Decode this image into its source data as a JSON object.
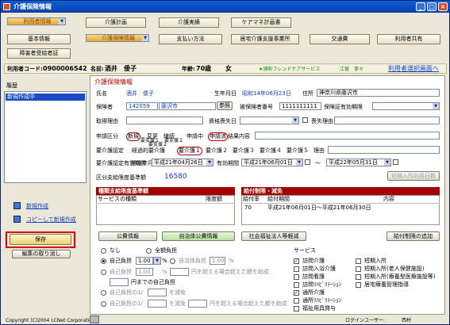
{
  "window": {
    "title": "介護保険情報"
  },
  "tabs_row1": [
    "利用者情報",
    "介護計画",
    "介護実績",
    "ケアマネ計画書"
  ],
  "tabs_row2": [
    "基本情報",
    "介護保険情報",
    "支払い方法",
    "居宅介護支援事業所",
    "交通費",
    "利用者共有"
  ],
  "tabs_row3": [
    "障害者受給者証"
  ],
  "header": {
    "user_code_label": "利用者コード:",
    "user_code": "0900006542",
    "name_label": "名前:",
    "name": "酒井　倭子",
    "age_label": "年齢:",
    "age": "70歳",
    "sex": "女",
    "office": "★浦和フレンドケアサービス",
    "staff": "江留　寧々",
    "select_link": "利用者選択画面へ"
  },
  "left": {
    "history_label": "履歴",
    "history_items": [
      "新規作成中"
    ],
    "new_link": "新規作成",
    "copy_link": "コピーして新規作成",
    "save_button": "保存",
    "cancel_button": "編集の取り消し"
  },
  "form": {
    "section_title": "介護保険情報",
    "name_label": "氏名",
    "name_value": "酒井　倭子",
    "birth_label": "生年月日",
    "birth_value": "昭和14年06月23日",
    "address_label": "住所",
    "address_value": "神奈川県藤沢市",
    "insurer_label": "保険者",
    "insurer_code": "142059",
    "insurer_city": "藤沢市",
    "ref_button": "参照",
    "insured_no_label": "被保険者番号",
    "insured_no": "1111111111",
    "cert_valid_label": "保険証有効期限",
    "acquire_reason_label": "取得理由",
    "loss_date_label": "資格喪失日",
    "loss_reason_label": "喪失理由",
    "apply_label": "申請区分",
    "apply_opts": [
      "新規",
      "変更",
      "継続",
      "申請中",
      "申請済",
      "結果内容"
    ],
    "shien_line1": "要支援１　要支援２",
    "shien_line2": "要支援２",
    "care_level_label": "要介護認定",
    "care_levels": [
      "経過的要介護",
      "要介護１",
      "要介護２",
      "要介護３",
      "要介護４",
      "要介護５",
      "理由"
    ],
    "period_label": "要介護認定有効期間",
    "period_start_label": "開始年月日",
    "period_start": "平成21年04月26日",
    "valid_label": "有効期間",
    "valid_start": "平成21年06月01日",
    "tilde": "～",
    "valid_end": "平成22年05月31日",
    "limit_label": "区分支給限度基準額",
    "limit_value": "16580",
    "short_stay_button": "短期入所利用日数",
    "grid1_title": "種類支給限度基準額",
    "grid1_cols": [
      "サービスの種類",
      "限度額"
    ],
    "grid2_title": "給付制限・減免",
    "grid2_cols": [
      "給付率",
      "給付期間",
      "内容"
    ],
    "grid2_row": [
      "70",
      "平成21年06月01日～平成21年06月30日",
      ""
    ],
    "btn_public": "公費情報",
    "btn_self_public": "自治体公費情報",
    "btn_welfare": "社会福祉法人等軽減",
    "btn_add_limit": "給付制限の追加",
    "burden": {
      "none": "なし",
      "full": "全額負担",
      "self": "自己負担",
      "self_value": "1.00",
      "pct": "%",
      "local": "自治体負担",
      "local_value": "1.00",
      "self2": "自己負担",
      "self2_value": "1.00",
      "over_text": "円を超える場合超えた額を助成",
      "yen_self": "円までの自己負担",
      "self_frac": "自己負担の1/",
      "exempt": "を減免",
      "self_frac2": "自己負担の1/",
      "exempt2": "を減免",
      "over_text2": "円を超える場合超えた額を助成"
    },
    "services_label": "サービス",
    "services_left": [
      {
        "label": "訪問介護",
        "checked": true
      },
      {
        "label": "訪問入浴介護",
        "checked": false
      },
      {
        "label": "訪問看護",
        "checked": false
      },
      {
        "label": "訪問ﾘﾊﾋﾞﾘﾃｰｼｮﾝ",
        "checked": false
      },
      {
        "label": "通所介護",
        "checked": true
      },
      {
        "label": "通所ﾘﾊﾋﾞﾘﾃｰｼｮﾝ",
        "checked": false
      },
      {
        "label": "福祉用具貸与",
        "checked": false
      }
    ],
    "services_right": [
      {
        "label": "短期入所",
        "checked": false
      },
      {
        "label": "短期入所(老人保健施設)",
        "checked": false
      },
      {
        "label": "短期入所(療養型医療施設等)",
        "checked": false
      },
      {
        "label": "居宅療養管理指導",
        "checked": false
      }
    ]
  },
  "footer": {
    "copyright": "Copyright (C)2004 LCNet Corporation",
    "login_label": "ログインユーザー:",
    "login_user": "西村"
  }
}
